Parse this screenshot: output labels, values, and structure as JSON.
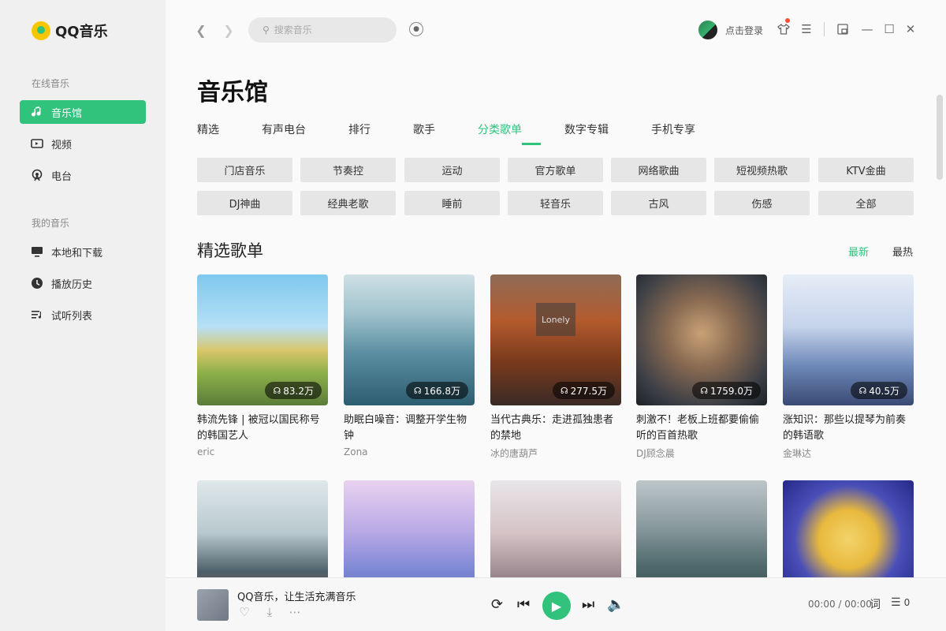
{
  "app": {
    "name": "QQ音乐"
  },
  "sidebar": {
    "online_section": "在线音乐",
    "my_section": "我的音乐",
    "online_items": [
      {
        "label": "音乐馆",
        "icon": "music-note-icon",
        "active": true
      },
      {
        "label": "视频",
        "icon": "video-icon",
        "active": false
      },
      {
        "label": "电台",
        "icon": "radio-icon",
        "active": false
      }
    ],
    "my_items": [
      {
        "label": "本地和下载",
        "icon": "monitor-icon"
      },
      {
        "label": "播放历史",
        "icon": "clock-icon"
      },
      {
        "label": "试听列表",
        "icon": "playlist-icon"
      }
    ]
  },
  "topbar": {
    "search_placeholder": "搜索音乐",
    "login_label": "点击登录"
  },
  "page": {
    "title": "音乐馆",
    "tabs": [
      "精选",
      "有声电台",
      "排行",
      "歌手",
      "分类歌单",
      "数字专辑",
      "手机专享"
    ],
    "active_tab": "分类歌单",
    "categories": [
      [
        "门店音乐",
        "节奏控",
        "运动",
        "官方歌单",
        "网络歌曲",
        "短视频热歌",
        "KTV金曲"
      ],
      [
        "DJ神曲",
        "经典老歌",
        "睡前",
        "轻音乐",
        "古风",
        "伤感",
        "全部"
      ]
    ],
    "section_title": "精选歌单",
    "sort_newest": "最新",
    "sort_hottest": "最热"
  },
  "playlists": [
    {
      "title": "韩流先锋 | 被冠以国民称号的韩国艺人",
      "author": "eric",
      "plays": "83.2万"
    },
    {
      "title": "助眠白噪音：调整开学生物钟",
      "author": "Zona",
      "plays": "166.8万"
    },
    {
      "title": "当代古典乐：走进孤独患者的禁地",
      "author": "冰的唐葫芦",
      "plays": "277.5万",
      "cover_text": "Lonely"
    },
    {
      "title": "刺激不！老板上班都要偷偷听的百首热歌",
      "author": "DJ顾念晨",
      "plays": "1759.0万"
    },
    {
      "title": "涨知识：那些以提琴为前奏的韩语歌",
      "author": "金琳达",
      "plays": "40.5万"
    }
  ],
  "player": {
    "title": "QQ音乐，让生活充满音乐",
    "time": "00:00 / 00:00",
    "lyric_label": "词",
    "playlist_count": "0"
  },
  "colors": {
    "accent": "#31c27c",
    "notification": "#ff4d36"
  }
}
